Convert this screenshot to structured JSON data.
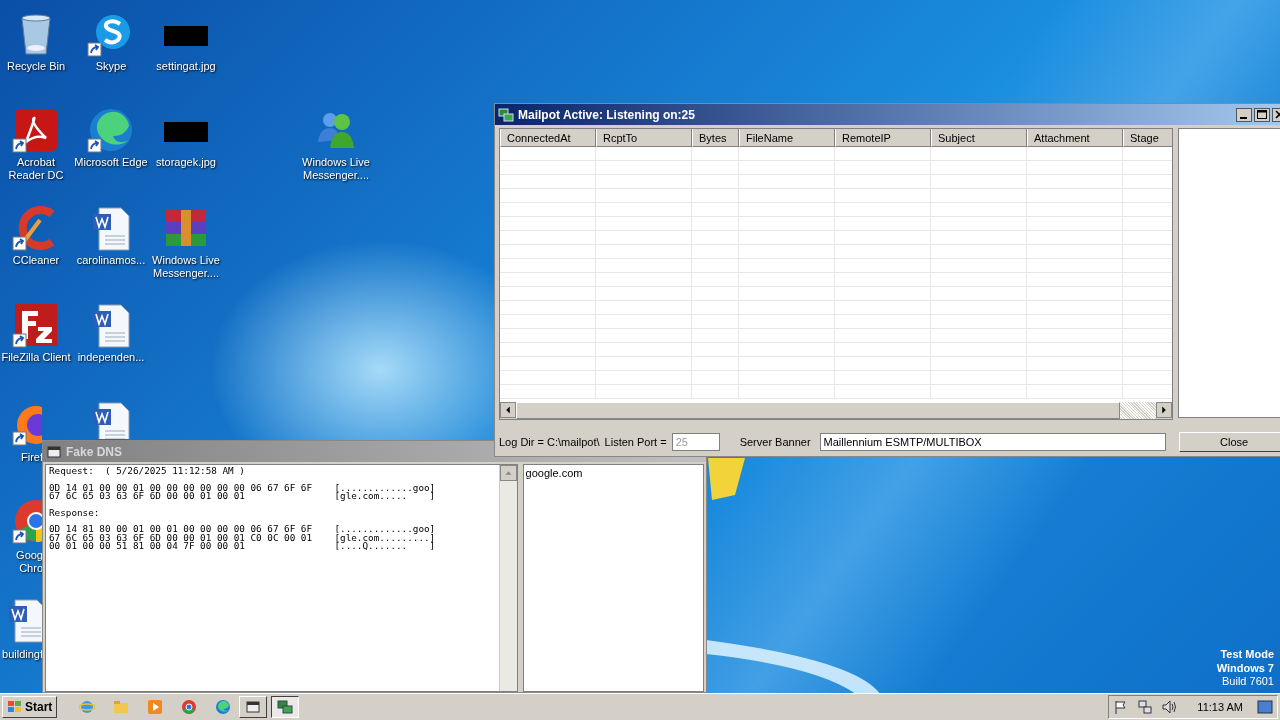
{
  "desktop_icons": [
    {
      "kind": "recycle",
      "label": [
        "Recycle Bin"
      ],
      "shortcut": false
    },
    {
      "kind": "skype",
      "label": [
        "Skype"
      ],
      "shortcut": true
    },
    {
      "kind": "image",
      "label": [
        "settingat.jpg"
      ],
      "shortcut": false
    },
    {
      "kind": "acrobat",
      "label": [
        "Acrobat",
        "Reader DC"
      ],
      "shortcut": true
    },
    {
      "kind": "edge",
      "label": [
        "Microsoft Edge"
      ],
      "shortcut": true
    },
    {
      "kind": "image",
      "label": [
        "storagek.jpg"
      ],
      "shortcut": false
    },
    {
      "kind": "messenger",
      "label": [
        "Windows Live",
        "Messenger...."
      ],
      "shortcut": false
    },
    {
      "kind": "ccleaner",
      "label": [
        "CCleaner"
      ],
      "shortcut": true
    },
    {
      "kind": "word",
      "label": [
        "carolinamos..."
      ],
      "shortcut": false
    },
    {
      "kind": "winrar",
      "label": [
        "Windows Live",
        "Messenger...."
      ],
      "shortcut": false
    },
    {
      "kind": "filezilla",
      "label": [
        "FileZilla Client"
      ],
      "shortcut": true
    },
    {
      "kind": "word",
      "label": [
        "independen..."
      ],
      "shortcut": false
    },
    {
      "kind": "firefox",
      "label": [
        "Firef"
      ],
      "shortcut": true
    },
    {
      "kind": "word",
      "shortcut": false
    },
    {
      "kind": "chrome",
      "label": [
        "Goog",
        "Chro"
      ],
      "shortcut": true
    },
    {
      "kind": "word",
      "label": [
        "buildingf"
      ],
      "shortcut": false
    }
  ],
  "mailpot_window": {
    "title": "Mailpot Active: Listening on:25",
    "active": true,
    "columns": [
      "ConnectedAt",
      "RcptTo",
      "Bytes",
      "FileName",
      "RemoteIP",
      "Subject",
      "Attachment",
      "Stage"
    ],
    "log_dir": "Log Dir = C:\\mailpot\\",
    "listen_port_label": "Listen Port =",
    "listen_port": {
      "value": "25",
      "disabled": true
    },
    "server_banner_label": "Server Banner",
    "server_banner": "Maillennium ESMTP/MULTIBOX",
    "close_button": "Close"
  },
  "fake_dns_window": {
    "title": "Fake DNS",
    "active": false,
    "log_blocks": [
      [
        "Request:  ( 5/26/2025 11:12:58 AM )"
      ],
      [
        "0D 14 01 00 00 01 00 00 00 00 00 00 06 67 6F 6F    [.............goo]",
        "67 6C 65 03 63 6F 6D 00 00 01 00 01                [gle.com.....    ]"
      ],
      [
        "Response:"
      ],
      [
        "0D 14 81 80 00 01 00 01 00 00 00 00 06 67 6F 6F    [.............goo]",
        "67 6C 65 03 63 6F 6D 00 00 01 00 01 C0 0C 00 01    [gle.com.........]",
        "00 01 00 00 51 81 00 04 7F 00 00 01                [....Q.......    ]"
      ]
    ],
    "domains": [
      "google.com"
    ]
  },
  "os_notice": [
    "Test Mode",
    "Windows 7",
    "Build 7601"
  ],
  "taskbar": {
    "start": "Start",
    "apps": [
      {
        "kind": "ie",
        "selected": false
      },
      {
        "kind": "explorer",
        "selected": false
      },
      {
        "kind": "media",
        "selected": false
      },
      {
        "kind": "chrome",
        "selected": false
      },
      {
        "kind": "edge",
        "selected": false
      },
      {
        "kind": "dns-window",
        "selected": false
      },
      {
        "kind": "mailpot-window",
        "selected": true
      }
    ],
    "clock": "11:13 AM"
  }
}
